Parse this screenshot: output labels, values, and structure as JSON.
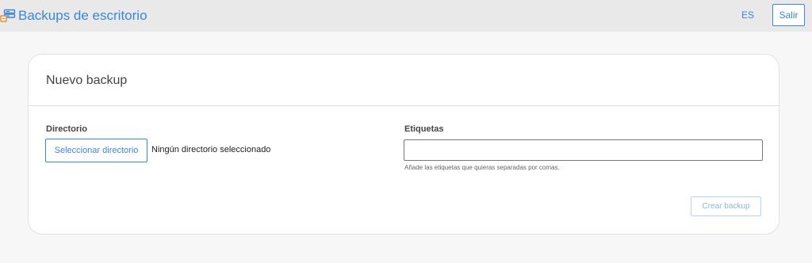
{
  "header": {
    "brand_icon": "server-backup-icon",
    "title": "Backups de escritorio",
    "language": "ES",
    "logout_label": "Salir"
  },
  "card": {
    "title": "Nuevo backup",
    "directory": {
      "label": "Directorio",
      "button_label": "Seleccionar directorio",
      "status": "Ningún directorio seleccionado"
    },
    "tags": {
      "label": "Etiquetas",
      "value": "",
      "help": "Añade las etiquetas que quieras separadas por comas."
    },
    "submit_label": "Crear backup"
  },
  "colors": {
    "accent": "#3a86d8",
    "icon_orange": "#e58a2e",
    "topbar": "#e9e9e9",
    "background": "#f7f7f7"
  }
}
